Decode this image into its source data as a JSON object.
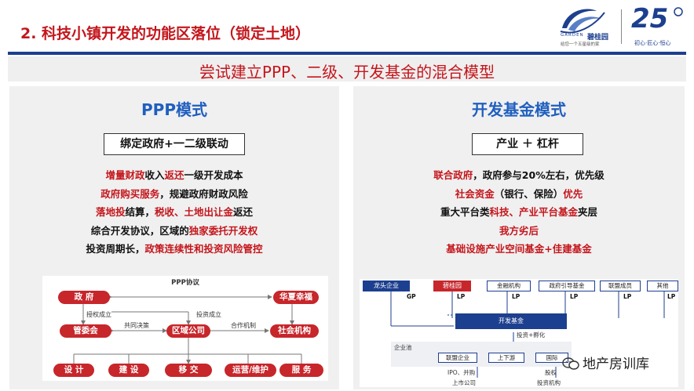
{
  "header": {
    "title": "2. 科技小镇开发的功能区落位（锁定土地）",
    "subtitle": "尝试建立PPP、二级、开发基金的混合模型"
  },
  "logo_left": {
    "name": "碧桂园",
    "latin": "GARDEN",
    "tagline": "给您一个五星级的家"
  },
  "logo_right": {
    "number": "25",
    "tagline": "初心·匠心·恒心"
  },
  "colors": {
    "red": "#c4161c",
    "blue": "#1f5fbf",
    "navy": "#1d3f8f",
    "panel": "#f0f0f0"
  },
  "left_panel": {
    "title": "PPP模式",
    "label": "绑定政府+一二级联动",
    "lines": [
      [
        {
          "t": "增量财政",
          "c": "red"
        },
        {
          "t": "收入",
          "c": "blk"
        },
        {
          "t": "返还",
          "c": "red"
        },
        {
          "t": "一级开发成本",
          "c": "blk"
        }
      ],
      [
        {
          "t": "政府购买服务",
          "c": "red"
        },
        {
          "t": "，规避政府财政风险",
          "c": "blk"
        }
      ],
      [
        {
          "t": "落地投",
          "c": "red"
        },
        {
          "t": "结算，",
          "c": "blk"
        },
        {
          "t": "税收、土地出让金",
          "c": "red"
        },
        {
          "t": "返还",
          "c": "blk"
        }
      ],
      [
        {
          "t": "综合开发协议，区域的",
          "c": "blk"
        },
        {
          "t": "独家委托开发权",
          "c": "red"
        }
      ],
      [
        {
          "t": "投资周期长，",
          "c": "blk"
        },
        {
          "t": "政策连续性和投资风险管控",
          "c": "red"
        }
      ]
    ],
    "diagram": {
      "title": "PPP协议",
      "nodes": {
        "gov": "政 府",
        "partner": "华夏幸福",
        "committee": "管委会",
        "company": "区域公司",
        "social": "社会机构"
      },
      "edge_labels": {
        "authorize": "授权成立",
        "co_decide": "共同决策",
        "invest": "投资成立",
        "cooperate": "合作机制"
      },
      "bottom": [
        "设 计",
        "建 设",
        "移 交",
        "运营/维护",
        "服 务"
      ]
    }
  },
  "right_panel": {
    "title": "开发基金模式",
    "label": "产业 ＋ 杠杆",
    "lines": [
      [
        {
          "t": "联合政府",
          "c": "red"
        },
        {
          "t": "，政府参与20%左右，优先级",
          "c": "blk"
        }
      ],
      [
        {
          "t": "社会资金",
          "c": "red"
        },
        {
          "t": "（银行、保险）",
          "c": "blk"
        },
        {
          "t": "优先",
          "c": "red"
        }
      ],
      [
        {
          "t": "重大平台类",
          "c": "blk"
        },
        {
          "t": "科技、产业平台基金",
          "c": "red"
        },
        {
          "t": "夹层",
          "c": "blk"
        }
      ],
      [
        {
          "t": "我方劣后",
          "c": "red"
        }
      ],
      [
        {
          "t": "基础设施产业空间基金+佳建基金",
          "c": "red"
        }
      ]
    ],
    "diagram": {
      "top": [
        "龙头企业",
        "碧桂园",
        "金融机构",
        "政府引导基金",
        "联盟成员",
        "其他"
      ],
      "gp": "GP",
      "lp": "LP",
      "fund": "开发基金",
      "invest": "投资+孵化",
      "pool": "企业池",
      "pool_items": [
        "联盟企业",
        "上下游",
        "国际"
      ],
      "exit_left": "IPO、并购",
      "exit_mid": "股权",
      "bottom_left": "上市公司",
      "bottom_right": "投资机构"
    }
  },
  "watermark": "地产房训库"
}
